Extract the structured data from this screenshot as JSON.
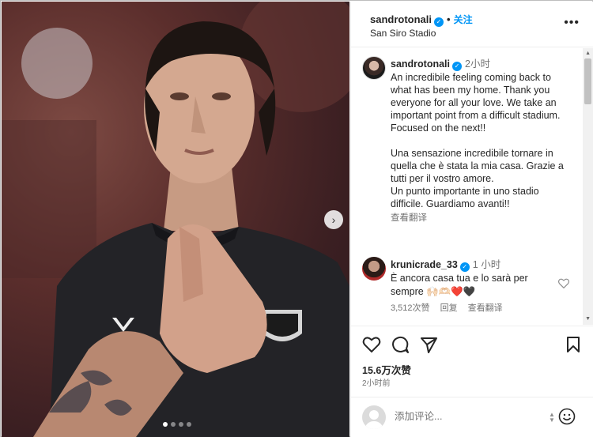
{
  "header": {
    "username": "sandrotonali",
    "follow_label": "关注",
    "separator": "•",
    "location": "San Siro Stadio",
    "more": "•••"
  },
  "caption": {
    "username": "sandrotonali",
    "time": "2小时",
    "paragraph_en": "An incredibile feeling coming back to what has been my home. Thank you everyone for all your love. We take an important point from a difficult stadium. Focused on the next!!",
    "paragraph_it": "Una sensazione incredibile tornare in quella che è stata la mia casa. Grazie a tutti per il vostro amore.\nUn punto importante in uno stadio difficile. Guardiamo avanti!!",
    "translate_label": "查看翻译"
  },
  "comment": {
    "username": "krunicrade_33",
    "time": "1 小时",
    "text": "È ancora casa tua e lo sarà per sempre 🙌🏻🫶🏻❤️🖤",
    "likes": "3,512次赞",
    "reply_label": "回复",
    "translate_label": "查看翻译"
  },
  "post": {
    "likes": "15.6万次赞",
    "time_ago": "2小时前"
  },
  "composer": {
    "placeholder": "添加评论..."
  },
  "carousel": {
    "next": "›",
    "slide_count": 4,
    "active_slide": 1
  },
  "colors": {
    "accent": "#0095f6",
    "text": "#262626",
    "muted": "#737373",
    "border": "#efefef"
  }
}
